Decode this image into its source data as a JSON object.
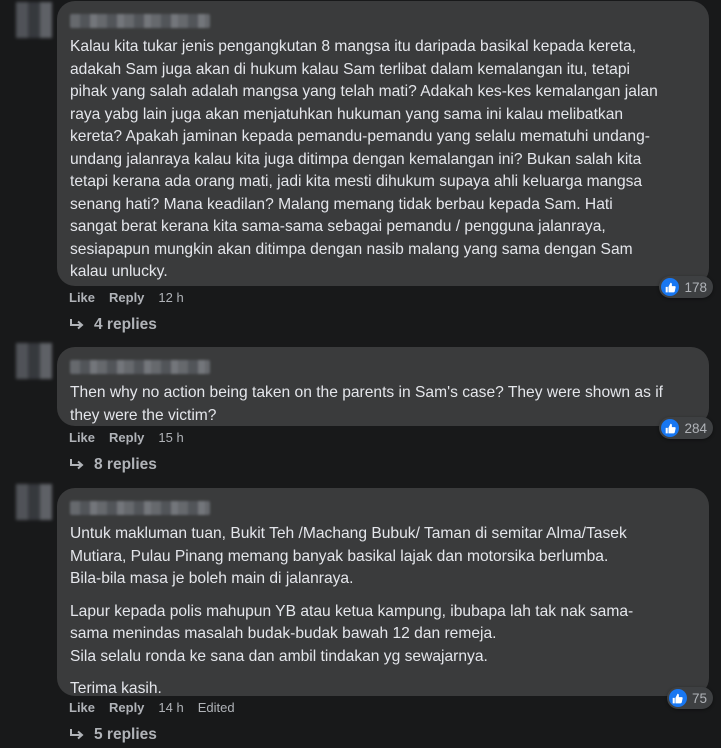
{
  "comments": [
    {
      "paragraphs": [
        "Kalau kita tukar jenis pengangkutan 8 mangsa itu daripada basikal kepada kereta,\nadakah Sam juga akan di hukum kalau Sam terlibat dalam kemalangan itu, tetapi\npihak yang salah adalah mangsa yang telah mati? Adakah kes-kes kemalangan jalan\nraya yabg lain juga akan menjatuhkan hukuman yang sama ini kalau melibatkan\nkereta? Apakah jaminan kepada pemandu-pemandu yang selalu mematuhi undang-\nundang jalanraya kalau kita juga ditimpa dengan kemalangan ini? Bukan salah kita\ntetapi kerana ada orang mati, jadi kita mesti dihukum supaya ahli keluarga mangsa\nsenang hati? Mana keadilan? Malang memang tidak berbau kepada Sam. Hati\nsangat berat kerana kita sama-sama sebagai pemandu / pengguna jalanraya,\nsesiapapun mungkin akan ditimpa dengan nasib malang yang sama dengan Sam\nkalau unlucky."
      ],
      "reactions": "178",
      "like_label": "Like",
      "reply_label": "Reply",
      "time": "12 h",
      "edited": "",
      "replies": "4 replies"
    },
    {
      "paragraphs": [
        "Then why no action being taken on the parents in Sam's case? They were shown as if\nthey were the victim?"
      ],
      "reactions": "284",
      "like_label": "Like",
      "reply_label": "Reply",
      "time": "15 h",
      "edited": "",
      "replies": "8 replies"
    },
    {
      "paragraphs": [
        "Untuk makluman tuan, Bukit Teh /Machang Bubuk/ Taman di semitar Alma/Tasek\nMutiara, Pulau Pinang memang banyak basikal lajak dan motorsika berlumba.\nBila-bila masa je boleh main di jalanraya.",
        "Lapur kepada polis mahupun YB atau ketua kampung, ibubapa lah tak nak sama-\nsama menindas masalah budak-budak bawah 12 dan remeja.\nSila selalu ronda ke sana dan ambil tindakan yg sewajarnya.",
        "Terima kasih."
      ],
      "reactions": "75",
      "like_label": "Like",
      "reply_label": "Reply",
      "time": "14 h",
      "edited": "Edited",
      "replies": "5 replies"
    }
  ],
  "icons": {
    "reaction": "thumbs-up-icon",
    "reply_arrow": "reply-arrow-icon"
  },
  "colors": {
    "background": "#18191a",
    "bubble": "#3a3b3c",
    "like_blue": "#1877f2",
    "muted": "#b0b3b8"
  }
}
